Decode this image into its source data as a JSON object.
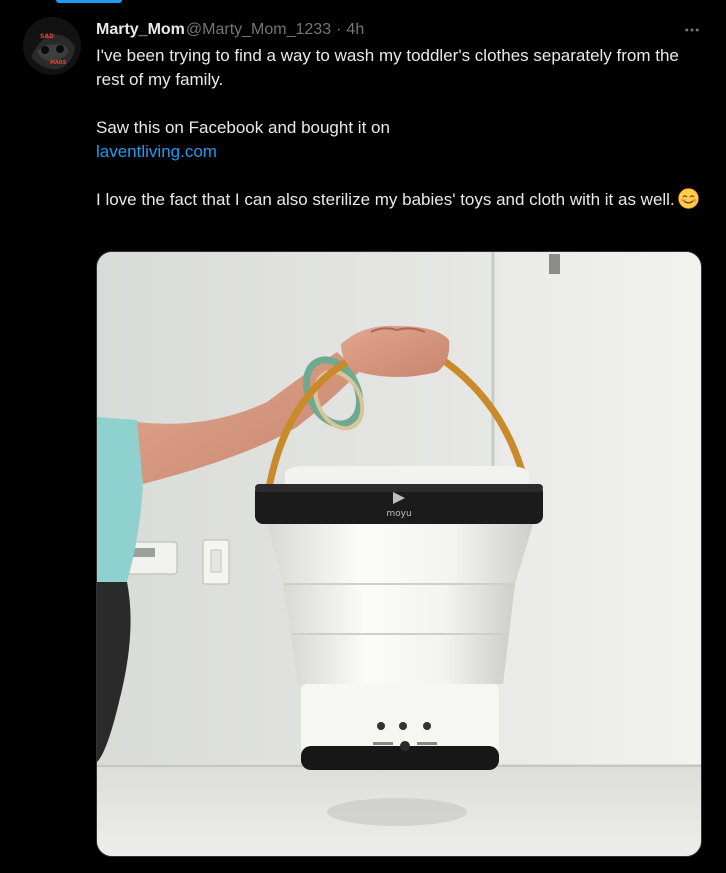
{
  "tweet": {
    "author": {
      "display_name": "Marty_Mom",
      "handle": "@Marty_Mom_1233",
      "avatar_text_top": "SAD",
      "avatar_text_bottom": "MARS"
    },
    "separator": "·",
    "timestamp": "4h",
    "text": {
      "line1": "I've been trying to find a way to wash my toddler's clothes separately from the rest of my family.",
      "line2_prefix": "Saw this on Facebook and bought it on",
      "link": "laventliving.com",
      "line3": "I love the fact that I can also sterilize my babies' toys and cloth with it as well."
    },
    "emoji": "smiling-face-emoji",
    "media": {
      "product_brand": "moyu"
    },
    "more_icon": "more-horizontal-icon"
  },
  "colors": {
    "background": "#000000",
    "text_primary": "#e7e9ea",
    "text_secondary": "#71767b",
    "link": "#1d9bf0",
    "border": "#2f3336"
  }
}
